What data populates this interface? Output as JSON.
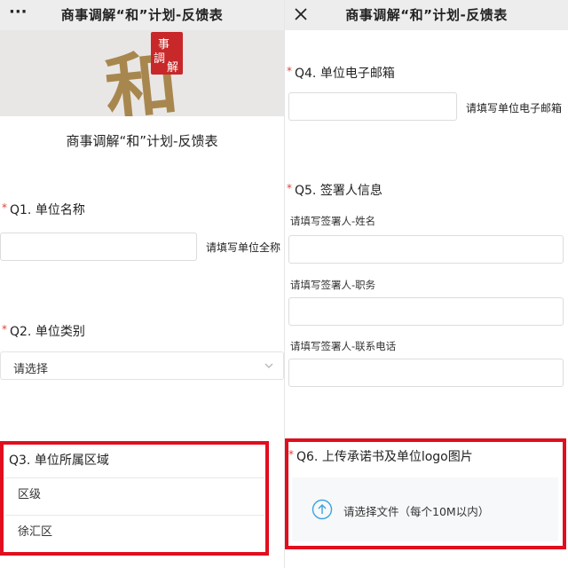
{
  "left": {
    "window_title": "商事调解“和”计划-反馈表",
    "menu_glyph": "···",
    "banner": {
      "logo_char": "和",
      "seal_text": [
        "事",
        "調",
        "解"
      ]
    },
    "form_title": "商事调解“和”计划-反馈表",
    "q1": {
      "required_mark": "*",
      "label": "Q1. 单位名称",
      "value": "",
      "hint": "请填写单位全称"
    },
    "q2": {
      "required_mark": "*",
      "label": "Q2. 单位类别",
      "selected": "请选择"
    },
    "q3": {
      "label": "Q3. 单位所属区域",
      "row1": "区级",
      "row2": "徐汇区"
    }
  },
  "right": {
    "window_title": "商事调解“和”计划-反馈表",
    "q4": {
      "required_mark": "*",
      "label": "Q4. 单位电子邮箱",
      "value": "",
      "hint": "请填写单位电子邮箱"
    },
    "q5": {
      "required_mark": "*",
      "label": "Q5. 签署人信息",
      "fields": [
        {
          "hint": "请填写签署人-姓名",
          "value": ""
        },
        {
          "hint": "请填写签署人-职务",
          "value": ""
        },
        {
          "hint": "请填写签署人-联系电话",
          "value": ""
        }
      ]
    },
    "q6": {
      "required_mark": "*",
      "label": "Q6. 上传承诺书及单位logo图片",
      "upload_text": "请选择文件（每个10M以内）"
    }
  },
  "colors": {
    "highlight": "#e10e1e",
    "required": "#e0433a",
    "titlebar": "#ededed",
    "upload_icon": "#3aa2e0",
    "banner_bg": "#e9e7e5",
    "logo_gold": "#a8874f"
  },
  "icons": {
    "menu": "more-dots-icon",
    "close": "close-icon",
    "dropdown": "chevron-down-icon",
    "upload": "upload-arrow-icon"
  }
}
